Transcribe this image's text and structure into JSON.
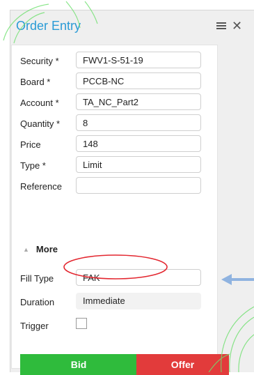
{
  "window": {
    "title": "Order Entry",
    "header_icons": [
      "menu-icon",
      "close-icon"
    ]
  },
  "form": {
    "fields": [
      {
        "label": "Security *",
        "value": "FWV1-S-51-19"
      },
      {
        "label": "Board *",
        "value": "PCCB-NC"
      },
      {
        "label": "Account *",
        "value": "TA_NC_Part2"
      },
      {
        "label": "Quantity *",
        "value": "8"
      },
      {
        "label": "Price",
        "value": "148"
      },
      {
        "label": "Type *",
        "value": "Limit"
      },
      {
        "label": "Reference",
        "value": ""
      }
    ],
    "more_label": "More",
    "extra_fields": [
      {
        "label": "Fill Type",
        "value": "FAK"
      },
      {
        "label": "Duration",
        "value": "Immediate"
      },
      {
        "label": "Trigger",
        "checked": false
      }
    ]
  },
  "buttons": {
    "bid": "Bid",
    "offer": "Offer",
    "bid_color": "#2fbb3c",
    "offer_color": "#e23b3b"
  },
  "annotations": {
    "highlight": "Fill Type field circled",
    "arrow": "blue arrow pointing left toward Duration",
    "accent_color": "#e3262f",
    "arrow_color": "#8fb3e0",
    "watermark_color": "#6ee06e"
  }
}
